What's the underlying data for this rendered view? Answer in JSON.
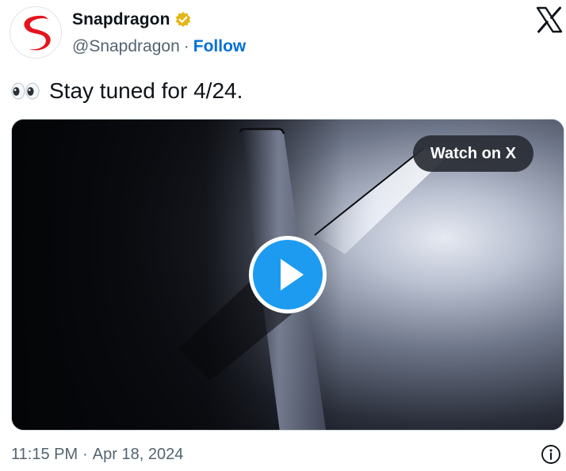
{
  "author": {
    "display_name": "Snapdragon",
    "handle": "@Snapdragon",
    "separator": "·",
    "follow_label": "Follow",
    "verified": true,
    "avatar_icon": "snapdragon-logo",
    "badge_color": "#e2b719"
  },
  "platform": {
    "logo_icon": "x-logo"
  },
  "tweet": {
    "emoji_icon": "eyes-emoji",
    "text": "Stay tuned for 4/24."
  },
  "media": {
    "type": "video",
    "watch_label": "Watch on X",
    "play_icon": "play-icon"
  },
  "footer": {
    "time": "11:15 PM",
    "separator": "·",
    "date": "Apr 18, 2024",
    "info_icon": "info-icon"
  },
  "colors": {
    "brand_red": "#e4151f",
    "link_blue": "#006fd6",
    "play_blue": "#1d9bf0",
    "secondary_text": "#536471"
  }
}
